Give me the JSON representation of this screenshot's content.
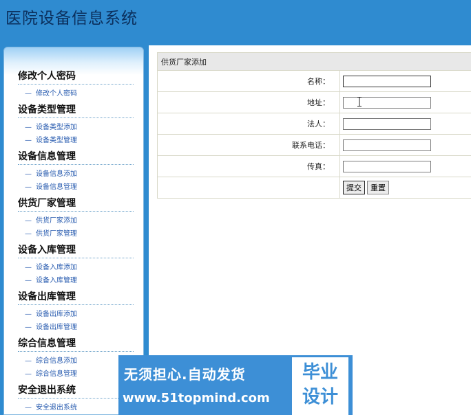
{
  "header": {
    "title": "医院设备信息系统"
  },
  "sidebar": {
    "groups": [
      {
        "title": "修改个人密码",
        "items": [
          "修改个人密码"
        ]
      },
      {
        "title": "设备类型管理",
        "items": [
          "设备类型添加",
          "设备类型管理"
        ]
      },
      {
        "title": "设备信息管理",
        "items": [
          "设备信息添加",
          "设备信息管理"
        ]
      },
      {
        "title": "供货厂家管理",
        "items": [
          "供货厂家添加",
          "供货厂家管理"
        ]
      },
      {
        "title": "设备入库管理",
        "items": [
          "设备入库添加",
          "设备入库管理"
        ]
      },
      {
        "title": "设备出库管理",
        "items": [
          "设备出库添加",
          "设备出库管理"
        ]
      },
      {
        "title": "综合信息管理",
        "items": [
          "综合信息添加",
          "综合信息管理"
        ]
      },
      {
        "title": "安全退出系统",
        "items": [
          "安全退出系统"
        ]
      }
    ],
    "dash": "—"
  },
  "form": {
    "caption": "供货厂家添加",
    "fields": [
      {
        "label": "名称：",
        "value": ""
      },
      {
        "label": "地址：",
        "value": ""
      },
      {
        "label": "法人：",
        "value": ""
      },
      {
        "label": "联系电话：",
        "value": ""
      },
      {
        "label": "传真：",
        "value": ""
      }
    ],
    "submit_label": "提交",
    "reset_label": "重置"
  },
  "watermark": {
    "slogan": "无须担心.自动发货",
    "url": "www.51topmind.com",
    "badge_line1": "毕业",
    "badge_line2": "设计"
  }
}
